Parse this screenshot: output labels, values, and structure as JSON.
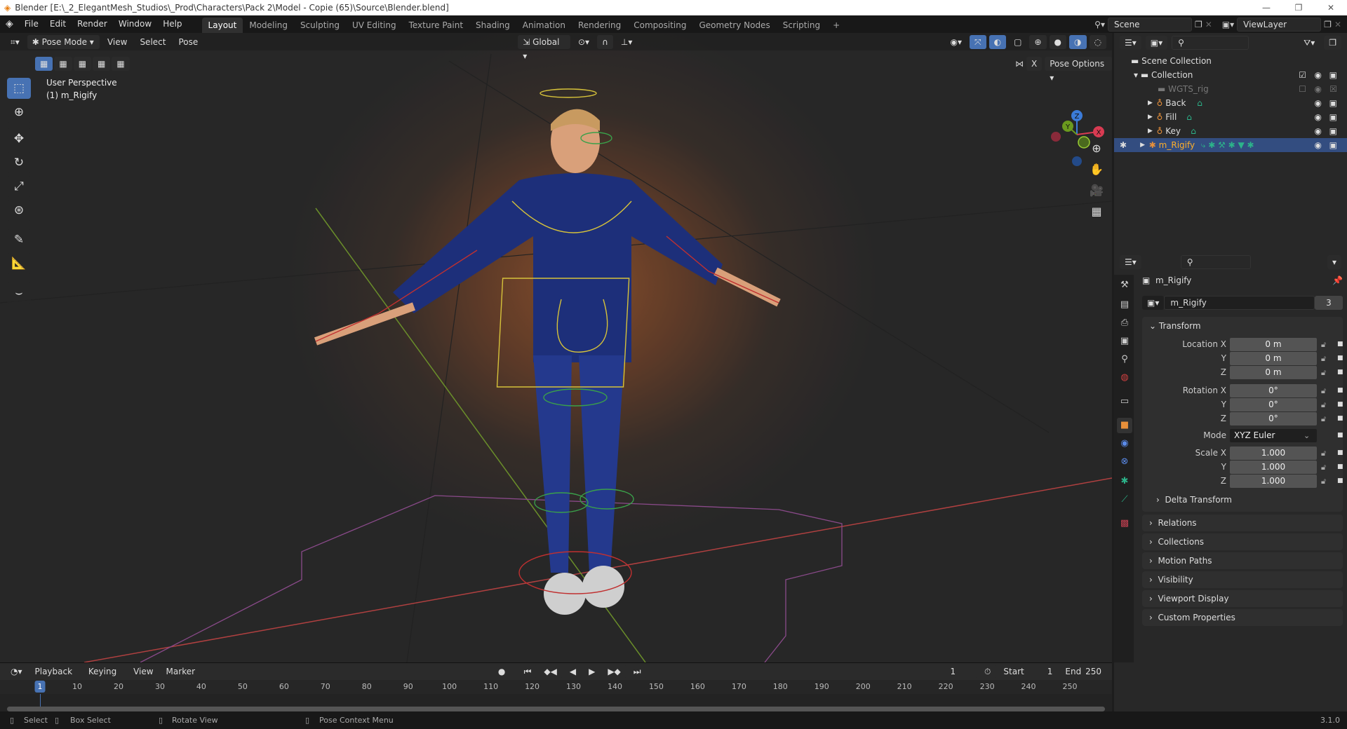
{
  "title": "Blender [E:\\_2_ElegantMesh_Studios\\_Prod\\Characters\\Pack 2\\Model - Copie (65)\\Source\\Blender.blend]",
  "menu": [
    "File",
    "Edit",
    "Render",
    "Window",
    "Help"
  ],
  "workspaces": [
    "Layout",
    "Modeling",
    "Sculpting",
    "UV Editing",
    "Texture Paint",
    "Shading",
    "Animation",
    "Rendering",
    "Compositing",
    "Geometry Nodes",
    "Scripting",
    "+"
  ],
  "scene": "Scene",
  "view_layer": "ViewLayer",
  "viewport": {
    "mode": "Pose Mode",
    "menus": [
      "View",
      "Select",
      "Pose"
    ],
    "orientation": "Global",
    "pose_options": "Pose Options",
    "x_label": "X",
    "overlay_title": "User Perspective",
    "overlay_sub": "(1) m_Rigify",
    "gizmo": {
      "x": "X",
      "y": "Y",
      "z": "Z"
    }
  },
  "outliner": {
    "root": "Scene Collection",
    "items": [
      {
        "name": "Collection"
      },
      {
        "name": "WGTS_rig"
      },
      {
        "name": "Back"
      },
      {
        "name": "Fill"
      },
      {
        "name": "Key"
      },
      {
        "name": "m_Rigify"
      }
    ]
  },
  "properties": {
    "object_name": "m_Rigify",
    "datablock": "m_Rigify",
    "users": "3",
    "transform": "Transform",
    "rows": [
      {
        "label": "Location X",
        "value": "0 m"
      },
      {
        "label": "Y",
        "value": "0 m"
      },
      {
        "label": "Z",
        "value": "0 m"
      },
      {
        "label": "Rotation X",
        "value": "0°"
      },
      {
        "label": "Y",
        "value": "0°"
      },
      {
        "label": "Z",
        "value": "0°"
      },
      {
        "label": "Mode",
        "value": "XYZ Euler"
      },
      {
        "label": "Scale X",
        "value": "1.000"
      },
      {
        "label": "Y",
        "value": "1.000"
      },
      {
        "label": "Z",
        "value": "1.000"
      }
    ],
    "delta": "Delta Transform",
    "panels": [
      "Relations",
      "Collections",
      "Motion Paths",
      "Visibility",
      "Viewport Display",
      "Custom Properties"
    ]
  },
  "timeline": {
    "menus": [
      "Playback",
      "Keying",
      "View",
      "Marker"
    ],
    "current": "1",
    "start_label": "Start",
    "start": "1",
    "end_label": "End",
    "end": "250",
    "ticks": [
      "1",
      "10",
      "20",
      "30",
      "40",
      "50",
      "60",
      "70",
      "80",
      "90",
      "100",
      "110",
      "120",
      "130",
      "140",
      "150",
      "160",
      "170",
      "180",
      "190",
      "200",
      "210",
      "220",
      "230",
      "240",
      "250"
    ]
  },
  "status": {
    "select": "Select",
    "box_select": "Box Select",
    "rotate": "Rotate View",
    "context": "Pose Context Menu",
    "version": "3.1.0"
  }
}
